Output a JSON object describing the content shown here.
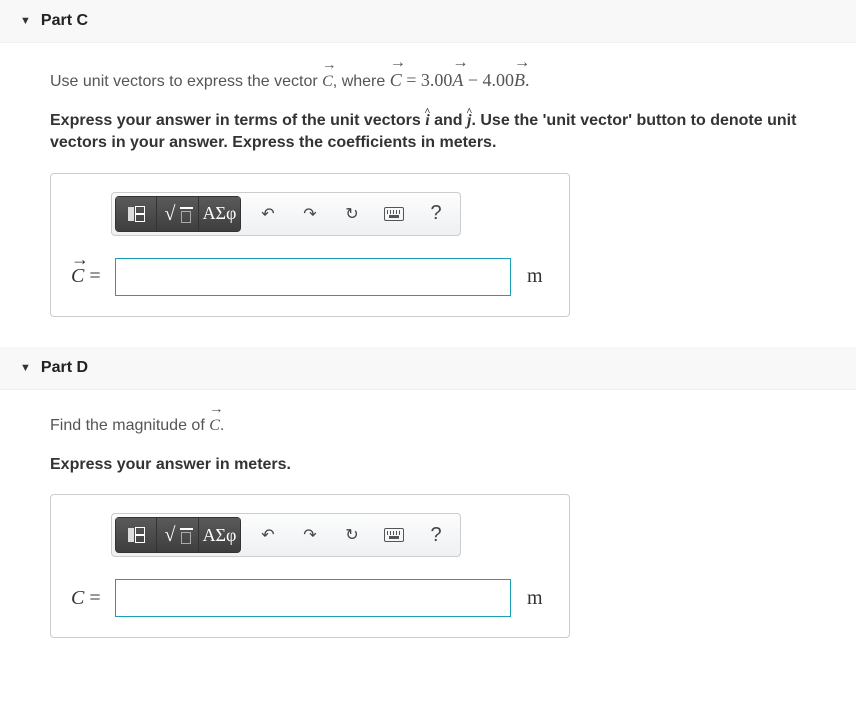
{
  "parts": [
    {
      "id": "C",
      "header": "Part C",
      "problem_html": "Use unit vectors to express the vector <span class='vec'><span class='arrow'>→</span>C</span>, where <span class='mathline'><span class='vec'><span class='arrow'>→</span>C</span> = 3.00<span class='vec'><span class='arrow'>→</span>A</span> − 4.00<span class='vec'><span class='arrow'>→</span>B</span>.</span>",
      "instruction_html": "Express your answer in terms of the unit vectors <span class='ivec'><span class='hat'>^</span><span class='dl'>i</span></span> and <span class='ivec'><span class='hat'>^</span><span class='dl'>j</span></span>. Use the 'unit vector' button to denote unit vectors in your answer. Express the coefficients in meters.",
      "lhs_html": "<span class='vec'><span class='arrow'>→</span>C</span> <span class='eqn'>=</span>",
      "value": "",
      "unit": "m"
    },
    {
      "id": "D",
      "header": "Part D",
      "problem_html": "Find the magnitude of <span class='vec'><span class='arrow'>→</span>C</span>.",
      "instruction_html": "Express your answer in meters.",
      "lhs_html": "C <span class='eqn'>=</span>",
      "value": "",
      "unit": "m"
    }
  ],
  "toolbar": {
    "templates_label": "templates",
    "symbols_label": "ΑΣφ",
    "undo": "undo",
    "redo": "redo",
    "reset": "reset",
    "keyboard": "keyboard",
    "help": "?"
  }
}
